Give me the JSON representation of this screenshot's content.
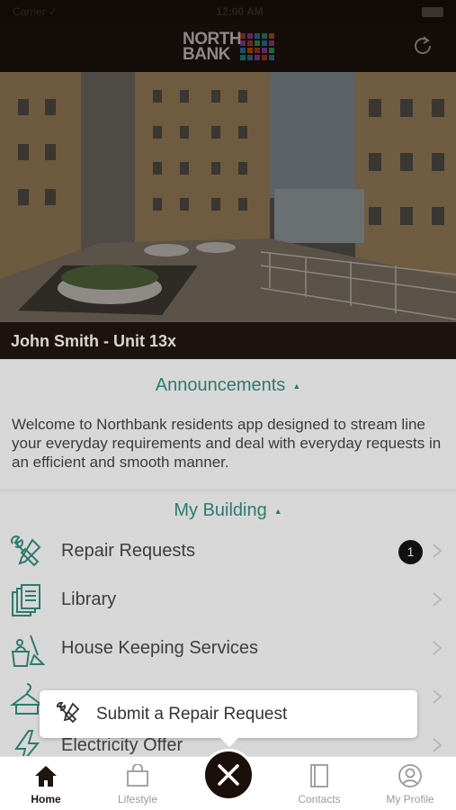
{
  "status_bar": {
    "left": "Carrier ✓",
    "center": "12:00 AM"
  },
  "header": {
    "logo_line1": "NORTH",
    "logo_line2": "BANK",
    "refresh_icon": "refresh-icon"
  },
  "resident": {
    "name_unit": "John Smith - Unit 13x"
  },
  "announcements": {
    "title": "Announcements",
    "caret": "▲",
    "text": "Welcome to Northbank residents app designed to stream line your everyday requirements and deal with everyday requests in an efficient and smooth manner."
  },
  "my_building": {
    "title": "My Building",
    "caret": "▲",
    "items": [
      {
        "label": "Repair Requests",
        "icon": "repair-tools-icon",
        "badge": "1"
      },
      {
        "label": "Library",
        "icon": "library-icon"
      },
      {
        "label": "House Keeping Services",
        "icon": "housekeeping-icon"
      },
      {
        "label": "",
        "icon": "laundry-icon"
      },
      {
        "label": "Electricity Offer",
        "icon": "electricity-icon"
      }
    ]
  },
  "popup": {
    "label": "Submit a Repair Request",
    "icon": "repair-tools-icon"
  },
  "tab_bar": {
    "tabs": [
      {
        "label": "Home",
        "icon": "home-icon",
        "active": true
      },
      {
        "label": "Lifestyle",
        "icon": "shopping-bag-icon"
      },
      {
        "label": "Contacts",
        "icon": "contacts-book-icon"
      },
      {
        "label": "My Profile",
        "icon": "profile-icon"
      }
    ],
    "center_button_icon": "close-icon"
  },
  "colors": {
    "accent_green": "#2f7a6d",
    "dark_brown": "#140d09",
    "overlay_bg": "#d7d7d7"
  }
}
